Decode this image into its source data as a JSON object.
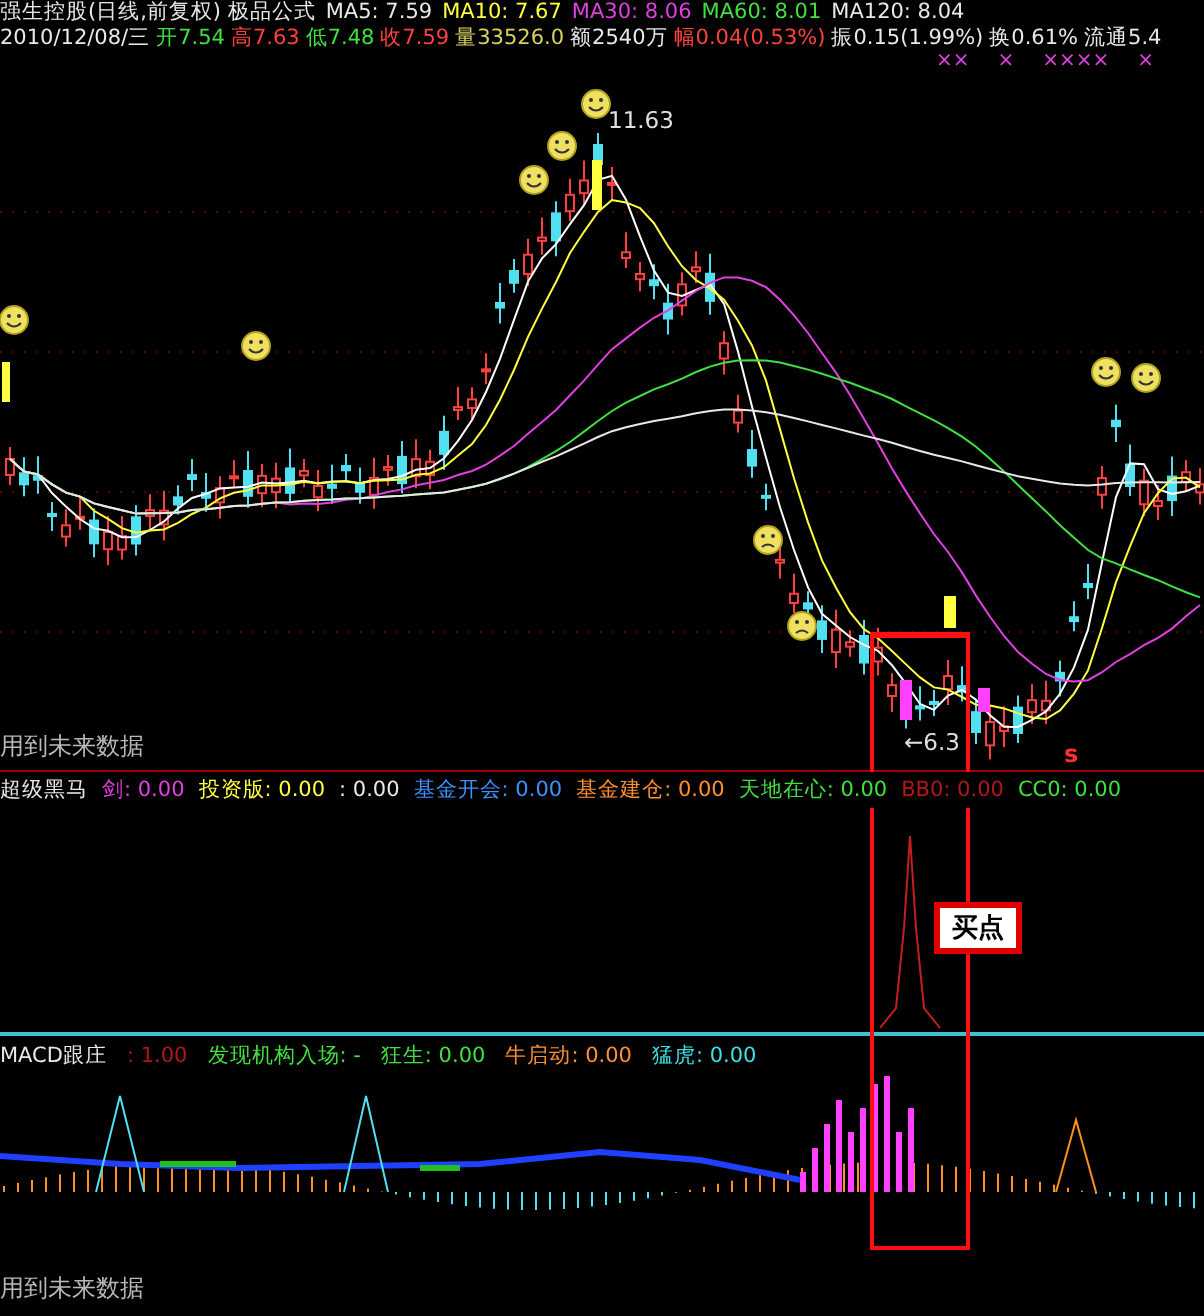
{
  "header": {
    "title": "强生控股(日线,前复权) 极品公式",
    "ma": [
      {
        "label": "MA5: 7.59",
        "color": "#e8e8e8"
      },
      {
        "label": "MA10: 7.67",
        "color": "#ffff40"
      },
      {
        "label": "MA30: 8.06",
        "color": "#e040e0"
      },
      {
        "label": "MA60: 8.01",
        "color": "#40e040"
      },
      {
        "label": "MA120: 8.04",
        "color": "#e8e8e8"
      }
    ],
    "quote": [
      {
        "label": "2010/12/08/三",
        "color": "#e8e8e8"
      },
      {
        "label": "开7.54",
        "color": "#40e040"
      },
      {
        "label": "高7.63",
        "color": "#ff4040"
      },
      {
        "label": "低7.48",
        "color": "#40e040"
      },
      {
        "label": "收7.59",
        "color": "#ff4040"
      },
      {
        "label": "量33526.0",
        "color": "#d8d060"
      },
      {
        "label": "额2540万",
        "color": "#e8e8e8"
      },
      {
        "label": "幅0.04(0.53%)",
        "color": "#ff4040"
      },
      {
        "label": "振0.15(1.99%)",
        "color": "#e8e8e8"
      },
      {
        "label": "换0.61%",
        "color": "#e8e8e8"
      },
      {
        "label": "流通5.4",
        "color": "#e8e8e8"
      }
    ],
    "marks": [
      "××",
      "×",
      "××××",
      "×"
    ]
  },
  "main_chart": {
    "high_label": "11.63",
    "low_label": "←6.3",
    "signal": "s",
    "note": "用到未来数据"
  },
  "indicator": {
    "title": "超级黑马",
    "items": [
      {
        "label": "剑: 0.00",
        "color": "#e040e0"
      },
      {
        "label": "投资版: 0.00",
        "color": "#ffff40"
      },
      {
        "label": ": 0.00",
        "color": "#e8e8e8"
      },
      {
        "label": "基金开会: 0.00",
        "color": "#4090ff"
      },
      {
        "label": "基金建仓: 0.00",
        "color": "#ff9030"
      },
      {
        "label": "天地在心: 0.00",
        "color": "#40e040"
      },
      {
        "label": "BB0: 0.00",
        "color": "#b01818"
      },
      {
        "label": "CC0: 0.00",
        "color": "#40e040"
      }
    ]
  },
  "buy_box": {
    "label": "买点"
  },
  "macd": {
    "title": "MACD跟庄",
    "items": [
      {
        "label": ": 1.00",
        "color": "#b01818"
      },
      {
        "label": "发现机构入场: -",
        "color": "#40e040"
      },
      {
        "label": "狂生: 0.00",
        "color": "#40e040"
      },
      {
        "label": "牛启动: 0.00",
        "color": "#ff9030"
      },
      {
        "label": "猛虎: 0.00",
        "color": "#40e0e0"
      }
    ],
    "note": "用到未来数据"
  }
}
